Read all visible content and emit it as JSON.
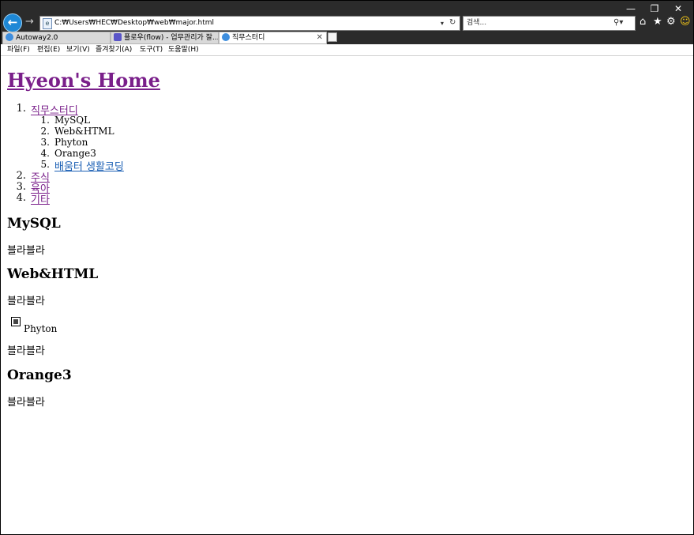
{
  "window": {
    "controls": {
      "minimize": "—",
      "maximize": "❐",
      "close": "✕"
    }
  },
  "toolbar": {
    "address": "C:₩Users₩HEC₩Desktop₩web₩major.html",
    "search_placeholder": "검색..."
  },
  "tabs": [
    {
      "label": "Autoway2.0",
      "icon": "ie-icon",
      "active": false
    },
    {
      "label": "플로우(flow) - 업무관리가 잘...",
      "icon": "flow-icon",
      "active": false
    },
    {
      "label": "직무스터디",
      "icon": "ie-icon",
      "active": true
    }
  ],
  "menu": [
    "파일(F)",
    "편집(E)",
    "보기(V)",
    "즐겨찾기(A)",
    "도구(T)",
    "도움말(H)"
  ],
  "page": {
    "title": "Hyeon's Home",
    "nav": [
      {
        "num": "1.",
        "label": "직무스터디"
      },
      {
        "num": "2.",
        "label": "주식"
      },
      {
        "num": "3.",
        "label": "육아"
      },
      {
        "num": "4.",
        "label": "기타"
      }
    ],
    "subnav": [
      {
        "num": "1.",
        "label": "MySQL"
      },
      {
        "num": "2.",
        "label": "Web&HTML"
      },
      {
        "num": "3.",
        "label": "Phyton"
      },
      {
        "num": "4.",
        "label": "Orange3"
      },
      {
        "num": "5.",
        "label": "배움터 생활코딩"
      }
    ],
    "sections": [
      {
        "heading": "MySQL",
        "body": "블라블라"
      },
      {
        "heading": "Web&HTML",
        "body": "블라블라"
      },
      {
        "image_alt": "Phyton",
        "body": "블라블라"
      },
      {
        "heading": "Orange3",
        "body": "블라블라"
      }
    ]
  },
  "colors": {
    "visited_link": "#7a1f8a",
    "link": "#1a5fb4",
    "chrome": "#2b2b2b"
  }
}
